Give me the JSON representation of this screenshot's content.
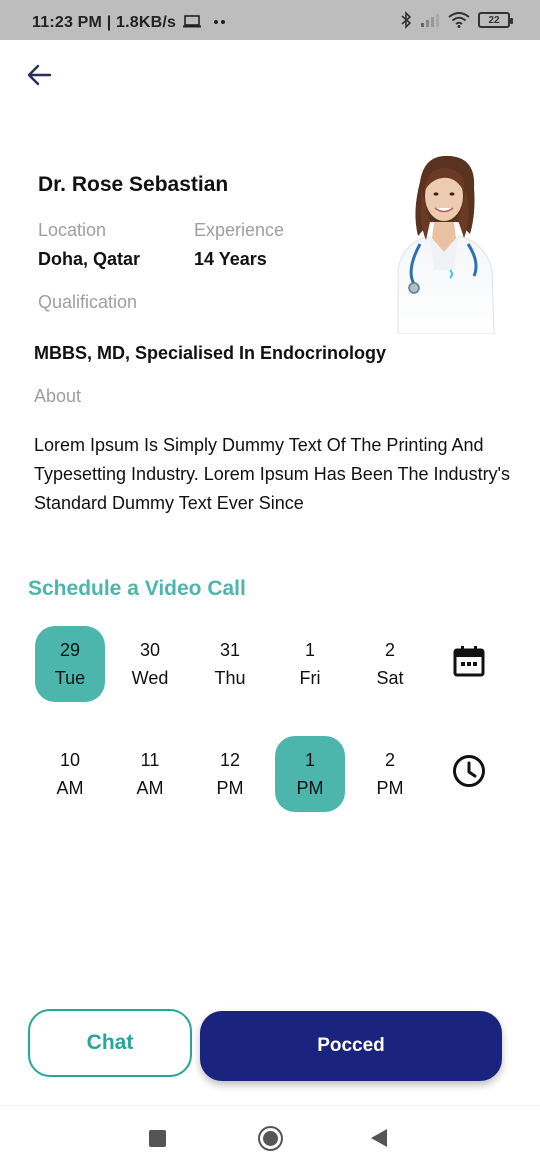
{
  "status_bar": {
    "time_speed": "11:23 PM | 1.8KB/s",
    "battery": "22"
  },
  "doctor": {
    "name": "Dr. Rose Sebastian",
    "location_label": "Location",
    "location": "Doha, Qatar",
    "experience_label": "Experience",
    "experience": "14 Years",
    "qualification_label": "Qualification",
    "qualification": "MBBS, MD, Specialised In Endocrinology",
    "about_label": "About",
    "about": "Lorem Ipsum Is Simply Dummy Text Of The Printing And Typesetting Industry. Lorem Ipsum Has Been The Industry's Standard Dummy Text Ever Since"
  },
  "schedule": {
    "title": "Schedule a Video Call",
    "dates": [
      {
        "day": "29",
        "weekday": "Tue"
      },
      {
        "day": "30",
        "weekday": "Wed"
      },
      {
        "day": "31",
        "weekday": "Thu"
      },
      {
        "day": "1",
        "weekday": "Fri"
      },
      {
        "day": "2",
        "weekday": "Sat"
      }
    ],
    "times": [
      {
        "hour": "10",
        "period": "AM"
      },
      {
        "hour": "11",
        "period": "AM"
      },
      {
        "hour": "12",
        "period": "PM"
      },
      {
        "hour": "1",
        "period": "PM"
      },
      {
        "hour": "2",
        "period": "PM"
      }
    ]
  },
  "actions": {
    "chat_label": "Chat",
    "proceed_label": "Pocced"
  },
  "colors": {
    "accent_teal": "#4db6ac",
    "primary_navy": "#1a237e"
  },
  "icons": {
    "back": "arrow-left-icon",
    "calendar": "calendar-icon",
    "clock": "clock-icon"
  }
}
